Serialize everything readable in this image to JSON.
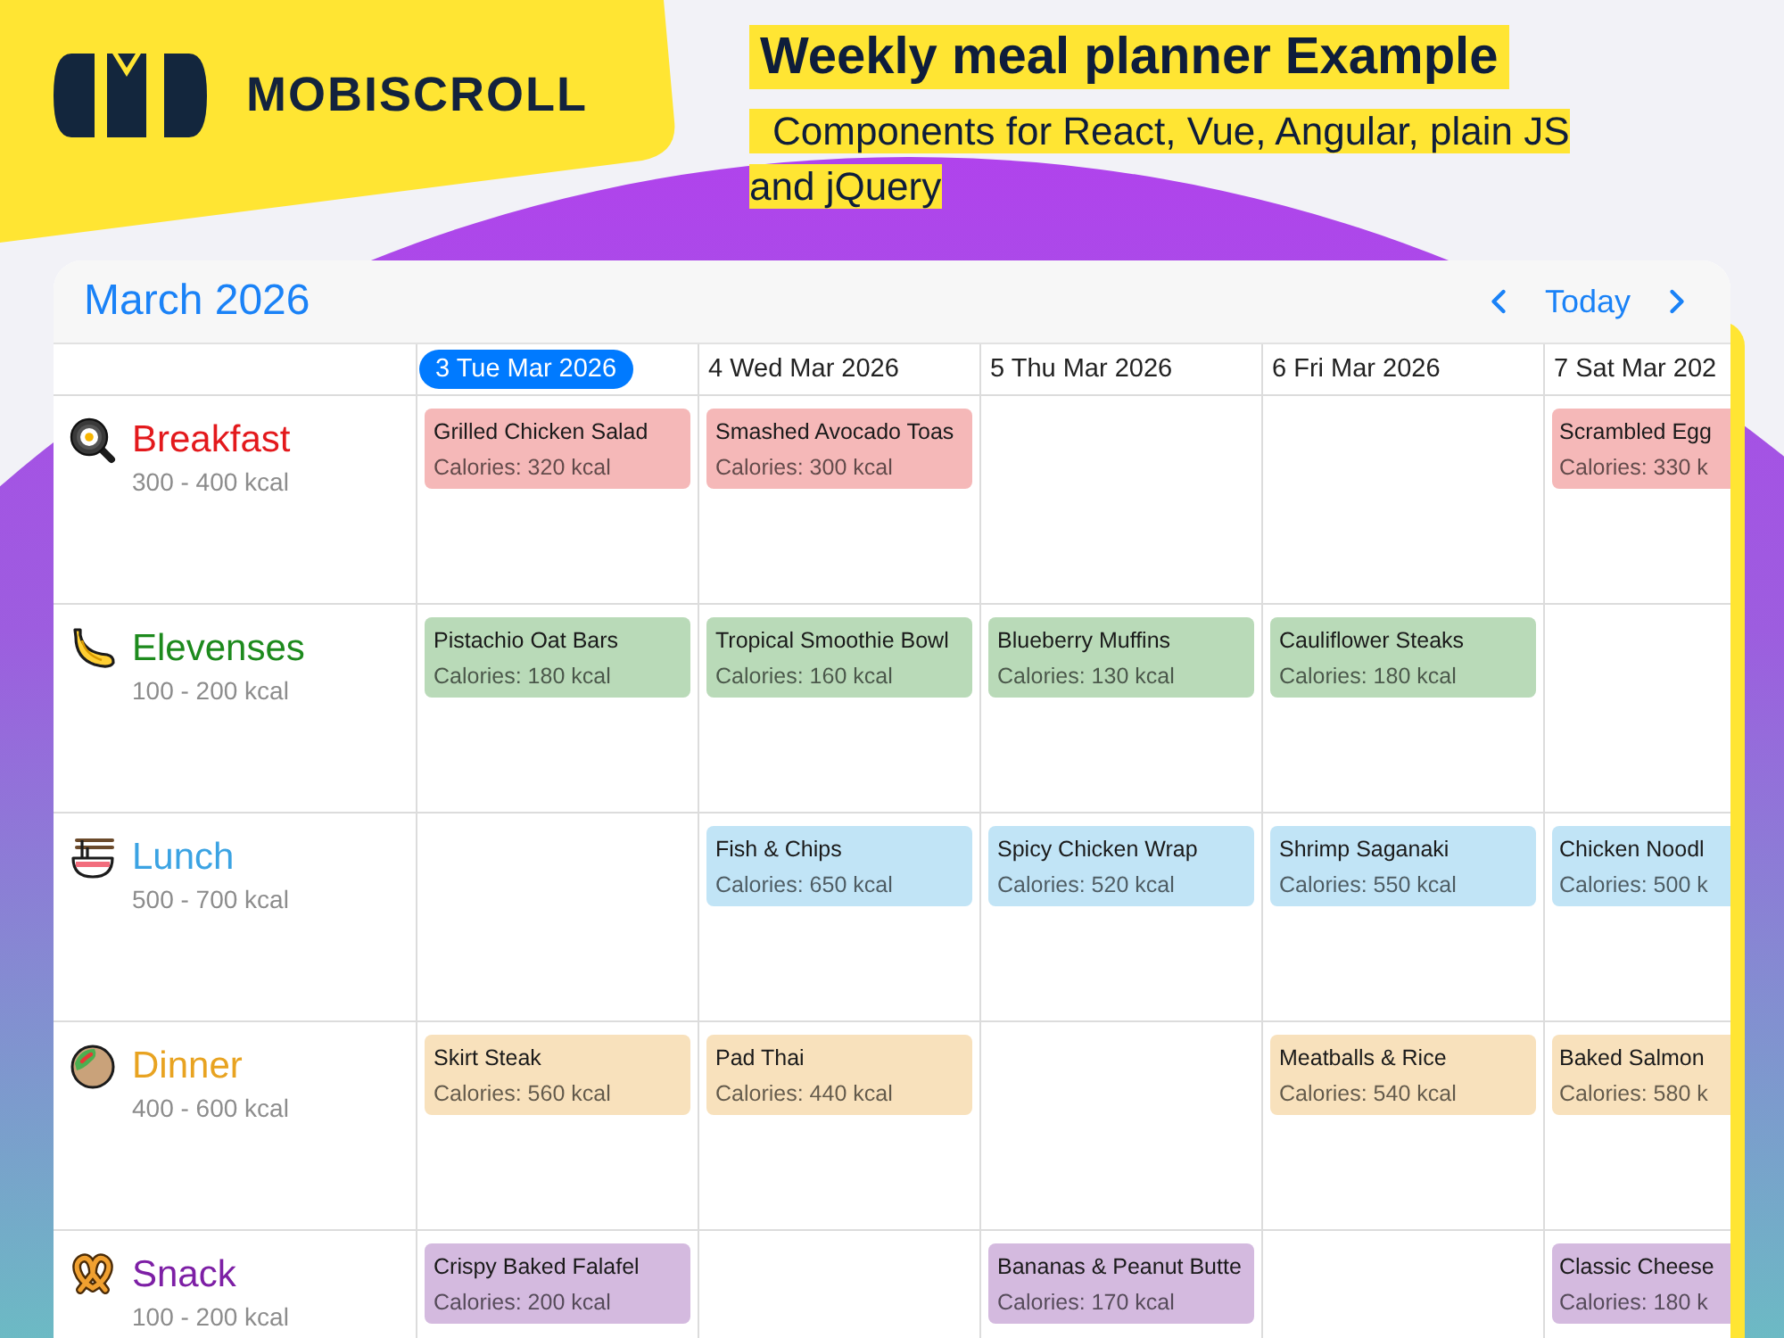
{
  "branding": {
    "logo_text": "MOBISCROLL"
  },
  "headline": {
    "title": "Weekly meal planner Example",
    "subtitle": "Components for React, Vue, Angular, plain JS and jQuery"
  },
  "calendar": {
    "month": "March 2026",
    "nav": {
      "today": "Today"
    },
    "days": [
      {
        "label": "3 Tue Mar 2026",
        "selected": true
      },
      {
        "label": "4 Wed Mar 2026",
        "selected": false
      },
      {
        "label": "5 Thu Mar 2026",
        "selected": false
      },
      {
        "label": "6 Fri Mar 2026",
        "selected": false
      },
      {
        "label": "7 Sat Mar 202",
        "selected": false
      }
    ],
    "meals": [
      {
        "name": "Breakfast",
        "range": "300 - 400 kcal",
        "kind": "pan",
        "color": "#e3191c",
        "slots": [
          {
            "kind": "event",
            "title": "Grilled Chicken Salad",
            "calories": "Calories: 320 kcal",
            "color": "#f5b8b8"
          },
          {
            "kind": "event",
            "title": "Smashed Avocado Toas",
            "calories": "Calories: 300 kcal",
            "color": "#f5b8b8"
          },
          {
            "kind": "empty"
          },
          {
            "kind": "empty"
          },
          {
            "kind": "event",
            "title": "Scrambled Egg",
            "calories": "Calories: 330 k",
            "color": "#f5b8b8"
          }
        ]
      },
      {
        "name": "Elevenses",
        "range": "100 - 200 kcal",
        "kind": "banana",
        "color": "#1d8a1d",
        "slots": [
          {
            "kind": "event",
            "title": "Pistachio Oat Bars",
            "calories": "Calories: 180 kcal",
            "color": "#b9dab8"
          },
          {
            "kind": "event",
            "title": "Tropical Smoothie Bowl",
            "calories": "Calories: 160 kcal",
            "color": "#b9dab8"
          },
          {
            "kind": "event",
            "title": "Blueberry Muffins",
            "calories": "Calories: 130 kcal",
            "color": "#b9dab8"
          },
          {
            "kind": "event",
            "title": "Cauliflower Steaks",
            "calories": "Calories: 180 kcal",
            "color": "#b9dab8"
          },
          {
            "kind": "empty"
          }
        ]
      },
      {
        "name": "Lunch",
        "range": "500 - 700 kcal",
        "kind": "noodles",
        "color": "#3ba3e3",
        "slots": [
          {
            "kind": "empty"
          },
          {
            "kind": "event",
            "title": "Fish & Chips",
            "calories": "Calories: 650 kcal",
            "color": "#c1e4f6"
          },
          {
            "kind": "event",
            "title": "Spicy Chicken Wrap",
            "calories": "Calories: 520 kcal",
            "color": "#c1e4f6"
          },
          {
            "kind": "event",
            "title": "Shrimp Saganaki",
            "calories": "Calories: 550 kcal",
            "color": "#c1e4f6"
          },
          {
            "kind": "event",
            "title": "Chicken Noodl",
            "calories": "Calories: 500 k",
            "color": "#c1e4f6"
          }
        ]
      },
      {
        "name": "Dinner",
        "range": "400 - 600 kcal",
        "kind": "wrap",
        "color": "#e8a321",
        "slots": [
          {
            "kind": "event",
            "title": "Skirt Steak",
            "calories": "Calories: 560 kcal",
            "color": "#f8e1bc"
          },
          {
            "kind": "event",
            "title": "Pad Thai",
            "calories": "Calories: 440 kcal",
            "color": "#f8e1bc"
          },
          {
            "kind": "empty"
          },
          {
            "kind": "event",
            "title": "Meatballs & Rice",
            "calories": "Calories: 540 kcal",
            "color": "#f8e1bc"
          },
          {
            "kind": "event",
            "title": "Baked Salmon",
            "calories": "Calories: 580 k",
            "color": "#f8e1bc"
          }
        ]
      },
      {
        "name": "Snack",
        "range": "100 - 200 kcal",
        "kind": "pretzel",
        "color": "#7d1fa5",
        "slots": [
          {
            "kind": "event",
            "title": "Crispy Baked Falafel",
            "calories": "Calories: 200 kcal",
            "color": "#d4badf"
          },
          {
            "kind": "empty"
          },
          {
            "kind": "event",
            "title": "Bananas & Peanut Butte",
            "calories": "Calories: 170 kcal",
            "color": "#d4badf"
          },
          {
            "kind": "empty"
          },
          {
            "kind": "event",
            "title": "Classic Cheese",
            "calories": "Calories: 180 k",
            "color": "#d4badf"
          }
        ]
      }
    ]
  }
}
